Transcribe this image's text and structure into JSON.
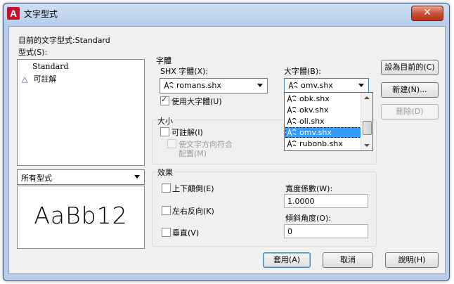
{
  "window": {
    "title": "文字型式",
    "close_glyph": "✕"
  },
  "current_style": "目前的文字型式:Standard",
  "styles_label": "型式(S):",
  "styles_list": [
    {
      "label": "Standard",
      "annotative": false
    },
    {
      "label": "可註解",
      "annotative": true
    }
  ],
  "filter_combo": {
    "value": "所有型式"
  },
  "preview_text": "AaBb12",
  "font_group": {
    "title": "字體",
    "shx_label": "SHX 字體(X):",
    "shx_value": "romans.shx",
    "bigfont_label": "大字體(B):",
    "bigfont_value": "omv.shx",
    "use_bigfont_label": "使用大字體(U)",
    "use_bigfont_checked": true,
    "bigfont_options": [
      "obk.shx",
      "okv.shx",
      "oli.shx",
      "omv.shx",
      "rubonb.shx"
    ],
    "bigfont_selected_index": 3
  },
  "size_group": {
    "title": "大小",
    "annotative_label": "可註解(I)",
    "match_orientation_line1": "使文字方向符合",
    "match_orientation_line2": "配置(M)"
  },
  "effects_group": {
    "title": "效果",
    "upside_down_label": "上下顛倒(E)",
    "backwards_label": "左右反向(K)",
    "vertical_label": "垂直(V)",
    "width_factor_label": "寬度係數(W):",
    "width_factor_value": "1.0000",
    "oblique_angle_label": "傾斜角度(O):",
    "oblique_angle_value": "0"
  },
  "buttons": {
    "set_current": "設為目前的(C)",
    "new": "新建(N)...",
    "delete": "刪除(D)",
    "apply": "套用(A)",
    "cancel": "取消",
    "help": "說明(H)"
  },
  "icons": {
    "app": "autocad-logo-icon",
    "annotative": "annotative-triangle-icon",
    "font": "shx-font-icon"
  }
}
